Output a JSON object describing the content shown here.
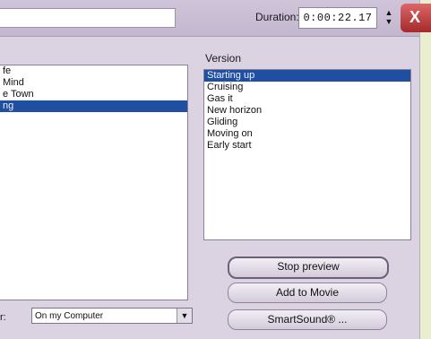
{
  "header": {
    "duration_label": "Duration:",
    "duration_value": "0:00:22.17",
    "spinner_glyph": "▲▼",
    "close_label": "X"
  },
  "music_list": {
    "items": [
      {
        "label": "fe",
        "selected": false
      },
      {
        "label": " Mind",
        "selected": false
      },
      {
        "label": "e Town",
        "selected": false
      },
      {
        "label": "ng",
        "selected": true
      }
    ]
  },
  "version": {
    "label": "Version",
    "items": [
      {
        "label": "Starting up",
        "selected": true
      },
      {
        "label": "Cruising",
        "selected": false
      },
      {
        "label": "Gas it",
        "selected": false
      },
      {
        "label": "New horizon",
        "selected": false
      },
      {
        "label": "Gliding",
        "selected": false
      },
      {
        "label": "Moving on",
        "selected": false
      },
      {
        "label": "Early start",
        "selected": false
      }
    ]
  },
  "buttons": {
    "stop_preview": "Stop preview",
    "add_to_movie": "Add to Movie",
    "smartsound": "SmartSound® ..."
  },
  "source": {
    "label": "r:",
    "selected": "On my Computer",
    "arrow_glyph": "▼"
  },
  "colors": {
    "selection": "#1f4fa0",
    "dialog_bg": "#dcd3e2",
    "close": "#b33333"
  }
}
